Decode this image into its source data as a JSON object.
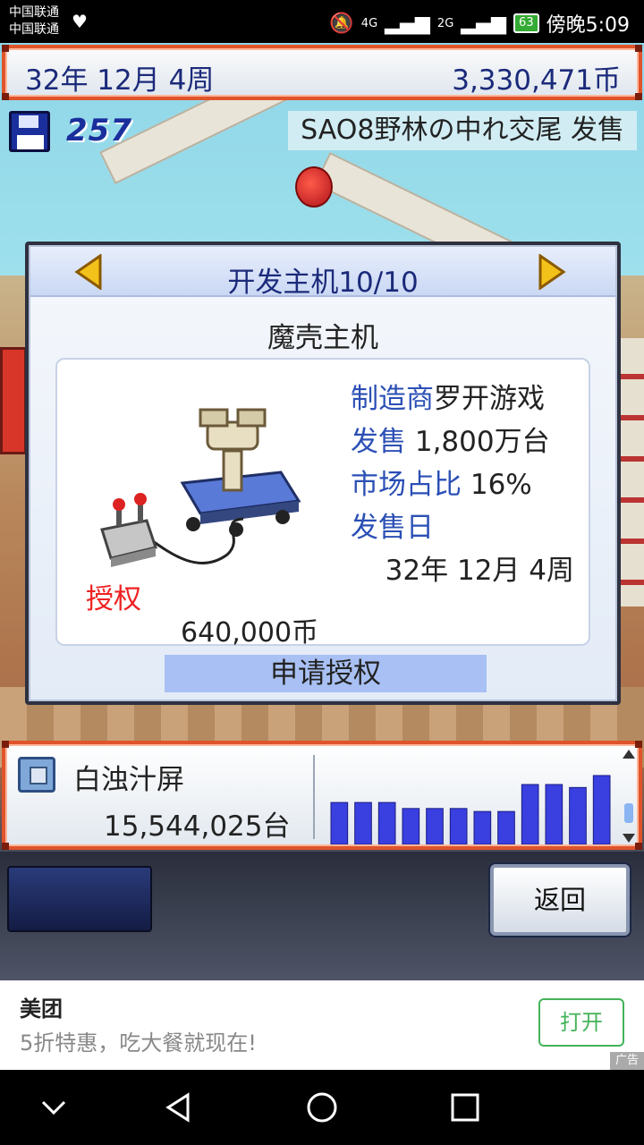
{
  "status_bar": {
    "carrier_1": "中国联通",
    "carrier_2": "中国联通",
    "network_4g": "4G",
    "network_2g": "2G",
    "battery": "63",
    "time": "傍晚5:09"
  },
  "top_bar": {
    "date": "32年 12月 4周",
    "money": "3,330,471币"
  },
  "save_row": {
    "count": "257",
    "headline": "SAO8野林の中れ交尾 发售"
  },
  "dialog": {
    "title": "开发主机10/10",
    "console_name": "魔壳主机",
    "specs": [
      {
        "key": "制造商",
        "value": "罗开游戏"
      },
      {
        "key": "发售",
        "value": " 1,800万台"
      },
      {
        "key": "市场占比",
        "value": "   16%"
      },
      {
        "key": "发售日",
        "value": ""
      }
    ],
    "release_date": "32年 12月 4周",
    "license_label": "授权",
    "license_price": "640,000币",
    "apply_button": "申请授权"
  },
  "sales_panel": {
    "product_name": "白浊汁屏",
    "units": "15,544,025台"
  },
  "chart_data": {
    "type": "bar",
    "values": [
      42,
      42,
      42,
      36,
      36,
      36,
      33,
      33,
      60,
      60,
      57,
      69
    ],
    "color": "#3a3fe0",
    "grid": false
  },
  "controls": {
    "back_button": "返回"
  },
  "ad": {
    "title": "美团",
    "description": "5折特惠，吃大餐就现在!",
    "open_button": "打开",
    "tag": "广告"
  }
}
